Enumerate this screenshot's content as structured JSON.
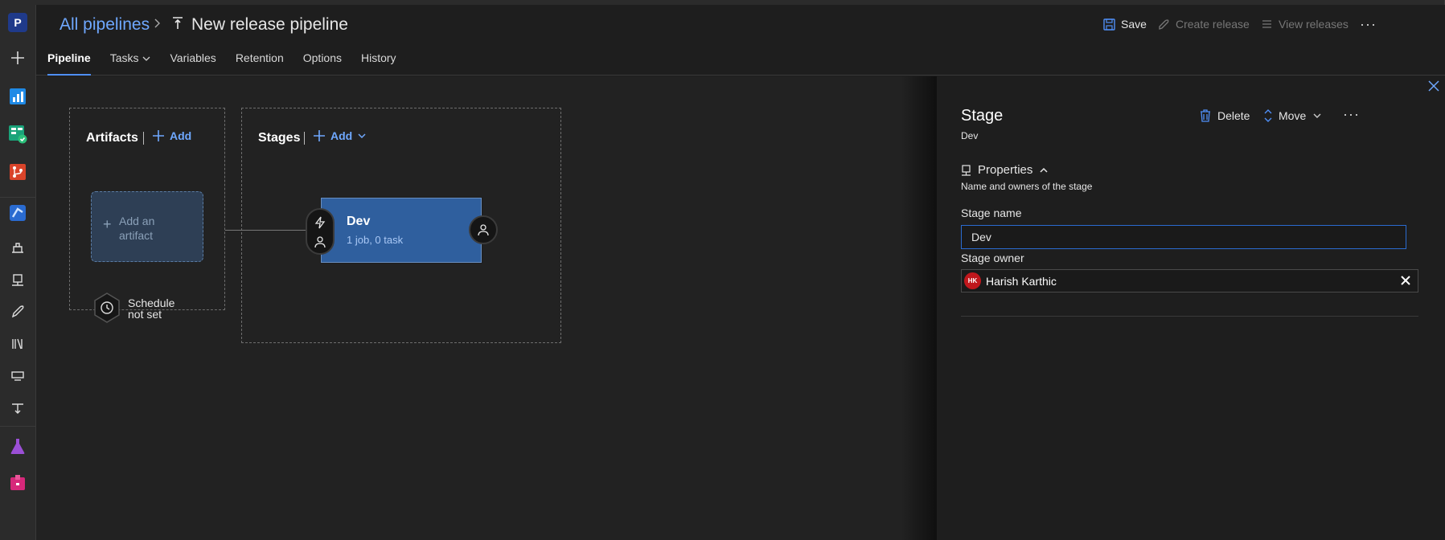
{
  "project": {
    "initial": "P"
  },
  "breadcrumb": {
    "parent": "All pipelines",
    "title": "New release pipeline"
  },
  "commands": {
    "save": "Save",
    "create_release": "Create release",
    "view_releases": "View releases",
    "more": "···"
  },
  "tabs": [
    {
      "label": "Pipeline",
      "active": true
    },
    {
      "label": "Tasks",
      "dropdown": true
    },
    {
      "label": "Variables"
    },
    {
      "label": "Retention"
    },
    {
      "label": "Options"
    },
    {
      "label": "History"
    }
  ],
  "artifacts": {
    "title": "Artifacts",
    "add": "Add",
    "card_line1": "Add an",
    "card_line2": "artifact",
    "schedule_line1": "Schedule",
    "schedule_line2": "not set"
  },
  "stages": {
    "title": "Stages",
    "add": "Add",
    "stage": {
      "name": "Dev",
      "summary": "1 job, 0 task"
    }
  },
  "panel": {
    "title": "Stage",
    "subtitle": "Dev",
    "delete": "Delete",
    "move": "Move",
    "more": "···",
    "properties": "Properties",
    "properties_desc": "Name and owners of the stage",
    "stage_name_label": "Stage name",
    "stage_name_value": "Dev",
    "stage_owner_label": "Stage owner",
    "owner": {
      "initials": "HK",
      "name": "Harish Karthic"
    }
  },
  "colors": {
    "accent": "#6fa8ff",
    "stage_card": "#2f5f9e",
    "avatar": "#c0171c"
  }
}
